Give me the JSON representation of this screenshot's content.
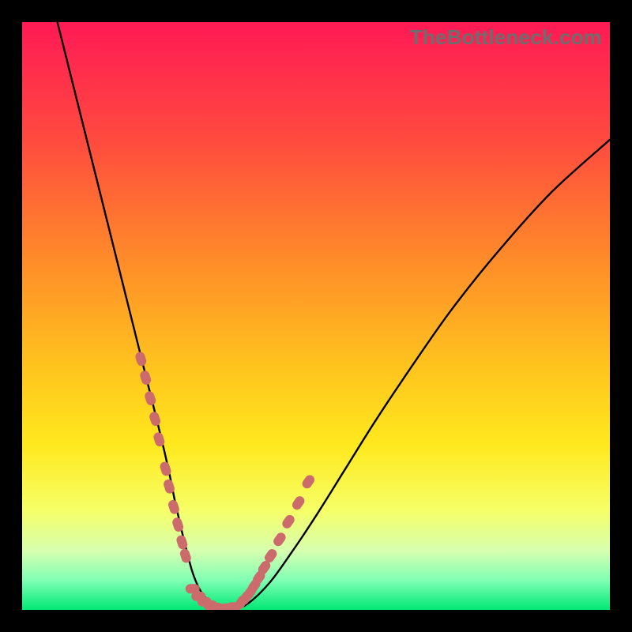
{
  "watermark": "TheBottleneck.com",
  "chart_data": {
    "type": "line",
    "title": "",
    "xlabel": "",
    "ylabel": "",
    "xlim": [
      0,
      100
    ],
    "ylim": [
      0,
      100
    ],
    "gradient_stops": [
      {
        "offset": 0.0,
        "color": "#ff1a55"
      },
      {
        "offset": 0.2,
        "color": "#ff4a3f"
      },
      {
        "offset": 0.4,
        "color": "#ff8a2a"
      },
      {
        "offset": 0.58,
        "color": "#ffc21e"
      },
      {
        "offset": 0.72,
        "color": "#ffe91e"
      },
      {
        "offset": 0.83,
        "color": "#f6ff66"
      },
      {
        "offset": 0.9,
        "color": "#d6ffb0"
      },
      {
        "offset": 0.95,
        "color": "#7fffb4"
      },
      {
        "offset": 1.0,
        "color": "#00e874"
      }
    ],
    "series": [
      {
        "name": "bottleneck-curve",
        "x": [
          6.0,
          8.5,
          11.0,
          13.5,
          16.0,
          18.0,
          20.0,
          21.5,
          23.0,
          24.2,
          25.2,
          26.0,
          26.8,
          27.5,
          28.2,
          28.8,
          29.5,
          30.2,
          31.0,
          32.2,
          33.6,
          35.2,
          38.0,
          42.0,
          46.0,
          50.0,
          55.0,
          60.0,
          66.0,
          73.0,
          81.0,
          90.0,
          100.0
        ],
        "y": [
          100.0,
          90.0,
          80.0,
          70.0,
          60.0,
          52.0,
          44.0,
          38.0,
          32.0,
          27.0,
          22.5,
          18.5,
          15.0,
          12.0,
          9.3,
          7.0,
          5.0,
          3.5,
          2.3,
          1.3,
          0.6,
          0.15,
          0.8,
          4.5,
          10.0,
          16.0,
          24.0,
          32.0,
          41.0,
          51.0,
          61.0,
          71.0,
          80.0
        ]
      }
    ],
    "markers": {
      "name": "reference-points",
      "color": "#cc6b6b",
      "left_branch": [
        [
          20.2,
          42.7
        ],
        [
          21.0,
          39.5
        ],
        [
          21.8,
          36.0
        ],
        [
          22.6,
          32.5
        ],
        [
          23.3,
          29.0
        ],
        [
          24.4,
          24.0
        ],
        [
          25.0,
          21.0
        ],
        [
          25.8,
          17.5
        ],
        [
          26.5,
          14.5
        ],
        [
          27.2,
          11.5
        ],
        [
          27.8,
          9.2
        ]
      ],
      "trough": [
        [
          29.0,
          3.6
        ],
        [
          30.0,
          2.3
        ],
        [
          31.0,
          1.4
        ],
        [
          32.0,
          0.8
        ],
        [
          33.0,
          0.4
        ],
        [
          34.0,
          0.25
        ],
        [
          35.0,
          0.3
        ],
        [
          36.0,
          0.5
        ]
      ],
      "right_branch": [
        [
          37.3,
          1.3
        ],
        [
          38.0,
          2.0
        ],
        [
          38.8,
          3.0
        ],
        [
          39.5,
          4.1
        ],
        [
          40.3,
          5.5
        ],
        [
          41.2,
          7.2
        ],
        [
          42.3,
          9.2
        ],
        [
          43.8,
          12.0
        ],
        [
          45.3,
          15.0
        ],
        [
          47.0,
          18.2
        ],
        [
          48.7,
          21.8
        ]
      ]
    }
  }
}
